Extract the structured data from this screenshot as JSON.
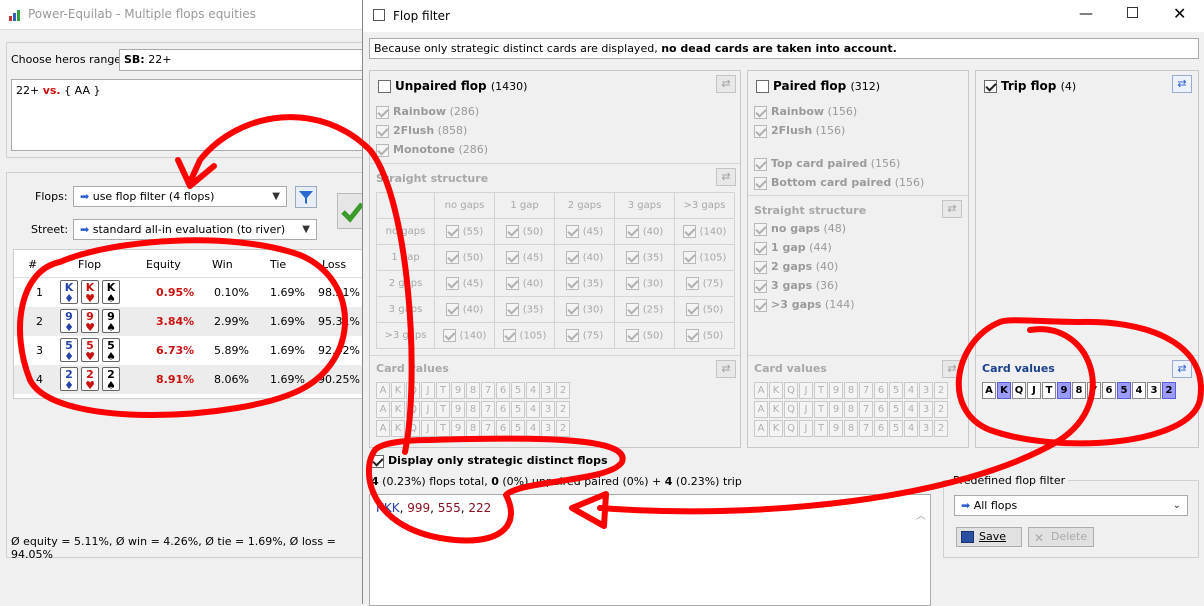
{
  "main_window": {
    "title": "Power-Equilab - Multiple flops equities",
    "range_label": "Choose heros range:",
    "range_value": "SB: 22+",
    "range_value_prefix": "SB:",
    "range_value_rest": " 22+",
    "textarea": {
      "left": "22+",
      "vs": "vs.",
      "right": "{ AA }"
    },
    "flops_label": "Flops:",
    "flops_value": "use flop filter (4 flops)",
    "street_label": "Street:",
    "street_value": "standard all-in evaluation (to river)",
    "table": {
      "columns": [
        "#",
        "Flop",
        "Equity",
        "Win",
        "Tie",
        "Loss"
      ],
      "rows": [
        {
          "num": "1",
          "cards": [
            {
              "rank": "K",
              "suit": "♦",
              "color": "blue"
            },
            {
              "rank": "K",
              "suit": "♥",
              "color": "red"
            },
            {
              "rank": "K",
              "suit": "♠",
              "color": "black"
            }
          ],
          "equity": "0.95%",
          "win": "0.10%",
          "tie": "1.69%",
          "loss": "98.21%"
        },
        {
          "num": "2",
          "cards": [
            {
              "rank": "9",
              "suit": "♦",
              "color": "blue"
            },
            {
              "rank": "9",
              "suit": "♥",
              "color": "red"
            },
            {
              "rank": "9",
              "suit": "♠",
              "color": "black"
            }
          ],
          "equity": "3.84%",
          "win": "2.99%",
          "tie": "1.69%",
          "loss": "95.31%"
        },
        {
          "num": "3",
          "cards": [
            {
              "rank": "5",
              "suit": "♦",
              "color": "blue"
            },
            {
              "rank": "5",
              "suit": "♥",
              "color": "red"
            },
            {
              "rank": "5",
              "suit": "♠",
              "color": "black"
            }
          ],
          "equity": "6.73%",
          "win": "5.89%",
          "tie": "1.69%",
          "loss": "92.42%"
        },
        {
          "num": "4",
          "cards": [
            {
              "rank": "2",
              "suit": "♦",
              "color": "blue"
            },
            {
              "rank": "2",
              "suit": "♥",
              "color": "red"
            },
            {
              "rank": "2",
              "suit": "♠",
              "color": "black"
            }
          ],
          "equity": "8.91%",
          "win": "8.06%",
          "tie": "1.69%",
          "loss": "90.25%"
        }
      ]
    },
    "summary": "Ø equity = 5.11%, Ø win = 4.26%, Ø tie = 1.69%, Ø loss = 94.05%"
  },
  "dialog": {
    "title": "Flop filter",
    "notice_text": "Because only strategic distinct cards are displayed, ",
    "notice_bold": "no dead cards are taken into account.",
    "unpaired": {
      "label": "Unpaired flop",
      "count": "(1430)",
      "options": [
        {
          "label": "Rainbow",
          "count": "(286)"
        },
        {
          "label": "2Flush",
          "count": "(858)"
        },
        {
          "label": "Monotone",
          "count": "(286)"
        }
      ],
      "straight_title": "Straight structure",
      "col_headers": [
        "no gaps",
        "1 gap",
        "2 gaps",
        "3 gaps",
        ">3 gaps"
      ],
      "row_headers": [
        "no gaps",
        "1 gap",
        "2 gaps",
        "3 gaps",
        ">3 gaps"
      ],
      "cells": [
        [
          "(55)",
          "(50)",
          "(45)",
          "(40)",
          "(140)"
        ],
        [
          "(50)",
          "(45)",
          "(40)",
          "(35)",
          "(105)"
        ],
        [
          "(45)",
          "(40)",
          "(35)",
          "(30)",
          "(75)"
        ],
        [
          "(40)",
          "(35)",
          "(30)",
          "(25)",
          "(50)"
        ],
        [
          "(140)",
          "(105)",
          "(75)",
          "(50)",
          "(50)"
        ]
      ],
      "card_values_title": "Card values"
    },
    "paired": {
      "label": "Paired flop",
      "count": "(312)",
      "options": [
        {
          "label": "Rainbow",
          "count": "(156)"
        },
        {
          "label": "2Flush",
          "count": "(156)"
        }
      ],
      "pair_options": [
        {
          "label": "Top card paired",
          "count": "(156)"
        },
        {
          "label": "Bottom card paired",
          "count": "(156)"
        }
      ],
      "straight_title": "Straight structure",
      "gap_options": [
        {
          "label": "no gaps",
          "count": "(48)"
        },
        {
          "label": "1 gap",
          "count": "(44)"
        },
        {
          "label": "2 gaps",
          "count": "(40)"
        },
        {
          "label": "3 gaps",
          "count": "(36)"
        },
        {
          "label": ">3 gaps",
          "count": "(144)"
        }
      ],
      "card_values_title": "Card values"
    },
    "trip": {
      "label": "Trip flop",
      "count": "(4)",
      "card_values_title": "Card values",
      "card_values": [
        {
          "v": "A",
          "state": "off"
        },
        {
          "v": "K",
          "state": "on"
        },
        {
          "v": "Q",
          "state": "off"
        },
        {
          "v": "J",
          "state": "off"
        },
        {
          "v": "T",
          "state": "off"
        },
        {
          "v": "9",
          "state": "on"
        },
        {
          "v": "8",
          "state": "off"
        },
        {
          "v": "7",
          "state": "off"
        },
        {
          "v": "6",
          "state": "off"
        },
        {
          "v": "5",
          "state": "on"
        },
        {
          "v": "4",
          "state": "off"
        },
        {
          "v": "3",
          "state": "off"
        },
        {
          "v": "2",
          "state": "on"
        }
      ]
    },
    "card_ranks": [
      "A",
      "K",
      "Q",
      "J",
      "T",
      "9",
      "8",
      "7",
      "6",
      "5",
      "4",
      "3",
      "2"
    ],
    "strategic_label": "Display only strategic distinct flops",
    "totals": {
      "total_count": "4",
      "total_pct": "(0.23%)",
      "total_word": "flops total,",
      "unpaired_count": "0",
      "unpaired_pct": "(0%)",
      "unpaired_word": "unpaired",
      "paired_text": "paired (0%)",
      "trip_count": "4",
      "trip_pct": "(0.23%)",
      "trip_word": "trip"
    },
    "result": [
      {
        "text": "KKK",
        "color": "#2c3fa0"
      },
      {
        "text": ", ",
        "color": "#000000"
      },
      {
        "text": "999",
        "color": "#8a1020"
      },
      {
        "text": ", ",
        "color": "#000000"
      },
      {
        "text": "555",
        "color": "#8a1020"
      },
      {
        "text": ", ",
        "color": "#000000"
      },
      {
        "text": "222",
        "color": "#8a1020"
      }
    ],
    "predefined_title": "Predefined flop filter",
    "predefined_value": "All flops",
    "save_label": "Save",
    "delete_label": "Delete"
  },
  "annotation_color": "#ff0000"
}
